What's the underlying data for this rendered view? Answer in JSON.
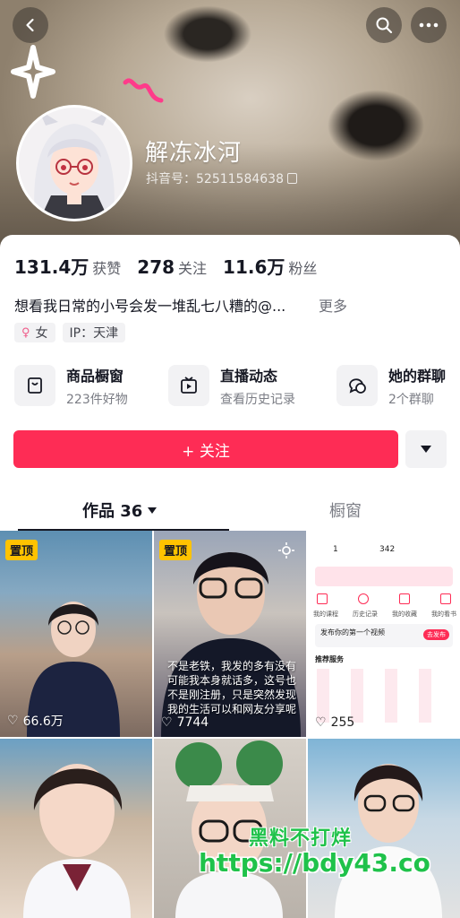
{
  "header": {
    "nickname": "解冻冰河",
    "douyin_id": "抖音号：52511584638"
  },
  "stats": [
    {
      "value": "131.4万",
      "label": "获赞"
    },
    {
      "value": "278",
      "label": "关注"
    },
    {
      "value": "11.6万",
      "label": "粉丝"
    }
  ],
  "bio": {
    "text": "想看我日常的小号会发一堆乱七八糟的@...",
    "more": "更多"
  },
  "tags": {
    "gender": "女",
    "ip": "IP：天津"
  },
  "services": [
    {
      "title": "商品橱窗",
      "subtitle": "223件好物",
      "icon": "shop-bag-icon"
    },
    {
      "title": "直播动态",
      "subtitle": "查看历史记录",
      "icon": "tv-icon"
    },
    {
      "title": "她的群聊",
      "subtitle": "2个群聊",
      "icon": "chat-bubbles-icon"
    }
  ],
  "follow_button": "+ 关注",
  "tabs": {
    "works": "作品 36",
    "window": "橱窗"
  },
  "videos": [
    {
      "pinned": "置顶",
      "likes": "66.6万",
      "caption": ""
    },
    {
      "pinned": "置顶",
      "likes": "7744",
      "caption": "不是老铁，我发的多有没有可能我本身就话多，这号也不是刚注册，只是突然发现我的生活可以和网友分享呢"
    },
    {
      "pinned": "",
      "likes": "255",
      "caption": ""
    },
    {
      "pinned": "",
      "likes": "",
      "caption": ""
    },
    {
      "pinned": "",
      "likes": "",
      "caption": ""
    },
    {
      "pinned": "",
      "likes": "",
      "caption": ""
    }
  ],
  "screenshot_tile": {
    "count_a": "1",
    "count_b": "342",
    "row1": [
      "我的课程",
      "历史记录",
      "我的收藏",
      "我的看书"
    ],
    "prompt": "发布你的第一个视频",
    "prompt_btn": "去发布",
    "section": "推荐服务"
  },
  "watermark": {
    "line1": "黑料不打烊",
    "line2": "https://bdy43.co"
  },
  "colors": {
    "accent": "#fe2c55",
    "pin": "#ffc300",
    "watermark": "#1fc24a"
  }
}
